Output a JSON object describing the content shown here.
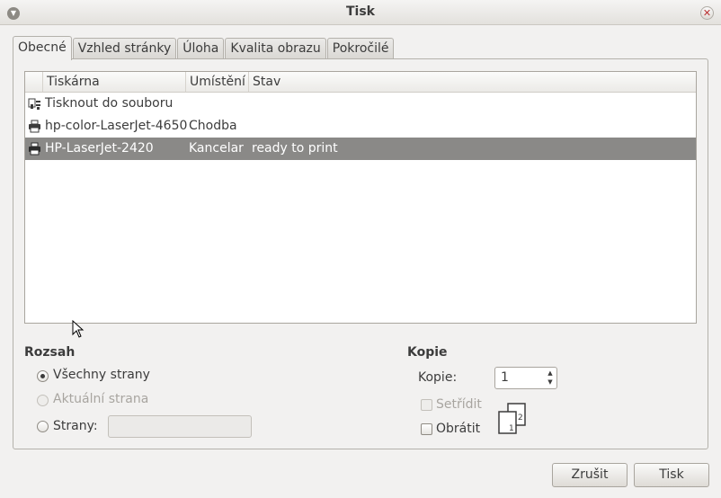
{
  "window": {
    "title": "Tisk"
  },
  "tabs": [
    {
      "label": "Obecné",
      "active": true
    },
    {
      "label": "Vzhled stránky",
      "active": false
    },
    {
      "label": "Úloha",
      "active": false
    },
    {
      "label": "Kvalita obrazu",
      "active": false
    },
    {
      "label": "Pokročilé",
      "active": false
    }
  ],
  "printer_list": {
    "columns": [
      "Tiskárna",
      "Umístění",
      "Stav"
    ],
    "rows": [
      {
        "icon": "file-printer-icon",
        "name": "Tisknout do souboru",
        "location": "",
        "status": "",
        "selected": false
      },
      {
        "icon": "printer-icon",
        "name": "hp-color-LaserJet-4650",
        "location": "Chodba",
        "status": "",
        "selected": false
      },
      {
        "icon": "printer-icon",
        "name": "HP-LaserJet-2420",
        "location": "Kancelar",
        "status": "ready to print",
        "selected": true
      }
    ]
  },
  "range": {
    "heading": "Rozsah",
    "all_pages": "Všechny strany",
    "current_page": "Aktuální strana",
    "pages": "Strany:",
    "pages_value": "",
    "selected": "all_pages"
  },
  "copies": {
    "heading": "Kopie",
    "copies_label": "Kopie:",
    "copies_value": "1",
    "collate": "Setřídit",
    "collate_checked": false,
    "collate_enabled": false,
    "reverse": "Obrátit",
    "reverse_checked": false,
    "page_numbers": [
      "1",
      "2"
    ]
  },
  "buttons": {
    "cancel": "Zrušit",
    "print": "Tisk"
  },
  "colors": {
    "selection": "#8a8987",
    "background": "#f2f1f0"
  }
}
